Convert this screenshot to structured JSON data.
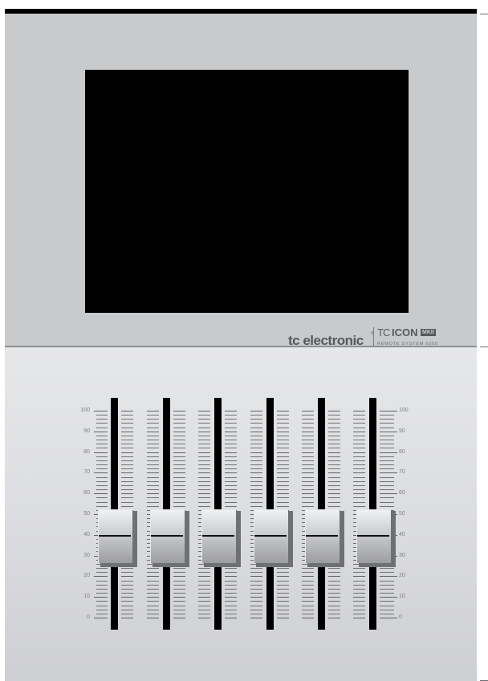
{
  "brand": {
    "name": "tc electronic",
    "registered_mark": "®",
    "product_prefix": "TC",
    "product_name": "ICON",
    "product_badge": "MKII",
    "product_subtitle": "REMOTE SYSTEM 6000"
  },
  "screen": {
    "state": "off",
    "color": "#000000"
  },
  "faders": {
    "count": 6,
    "scale_labels": [
      "100",
      "90",
      "80",
      "70",
      "60",
      "50",
      "40",
      "30",
      "20",
      "10",
      "0"
    ],
    "positions": [
      {
        "label": "fader-1",
        "level": 40
      },
      {
        "label": "fader-2",
        "level": 40
      },
      {
        "label": "fader-3",
        "level": 40
      },
      {
        "label": "fader-4",
        "level": 40
      },
      {
        "label": "fader-5",
        "level": 40
      },
      {
        "label": "fader-6",
        "level": 40
      }
    ]
  },
  "colors": {
    "panel_upper": "#c9cacc",
    "panel_lower": "#dcdde0",
    "logo_text": "#58595b"
  }
}
